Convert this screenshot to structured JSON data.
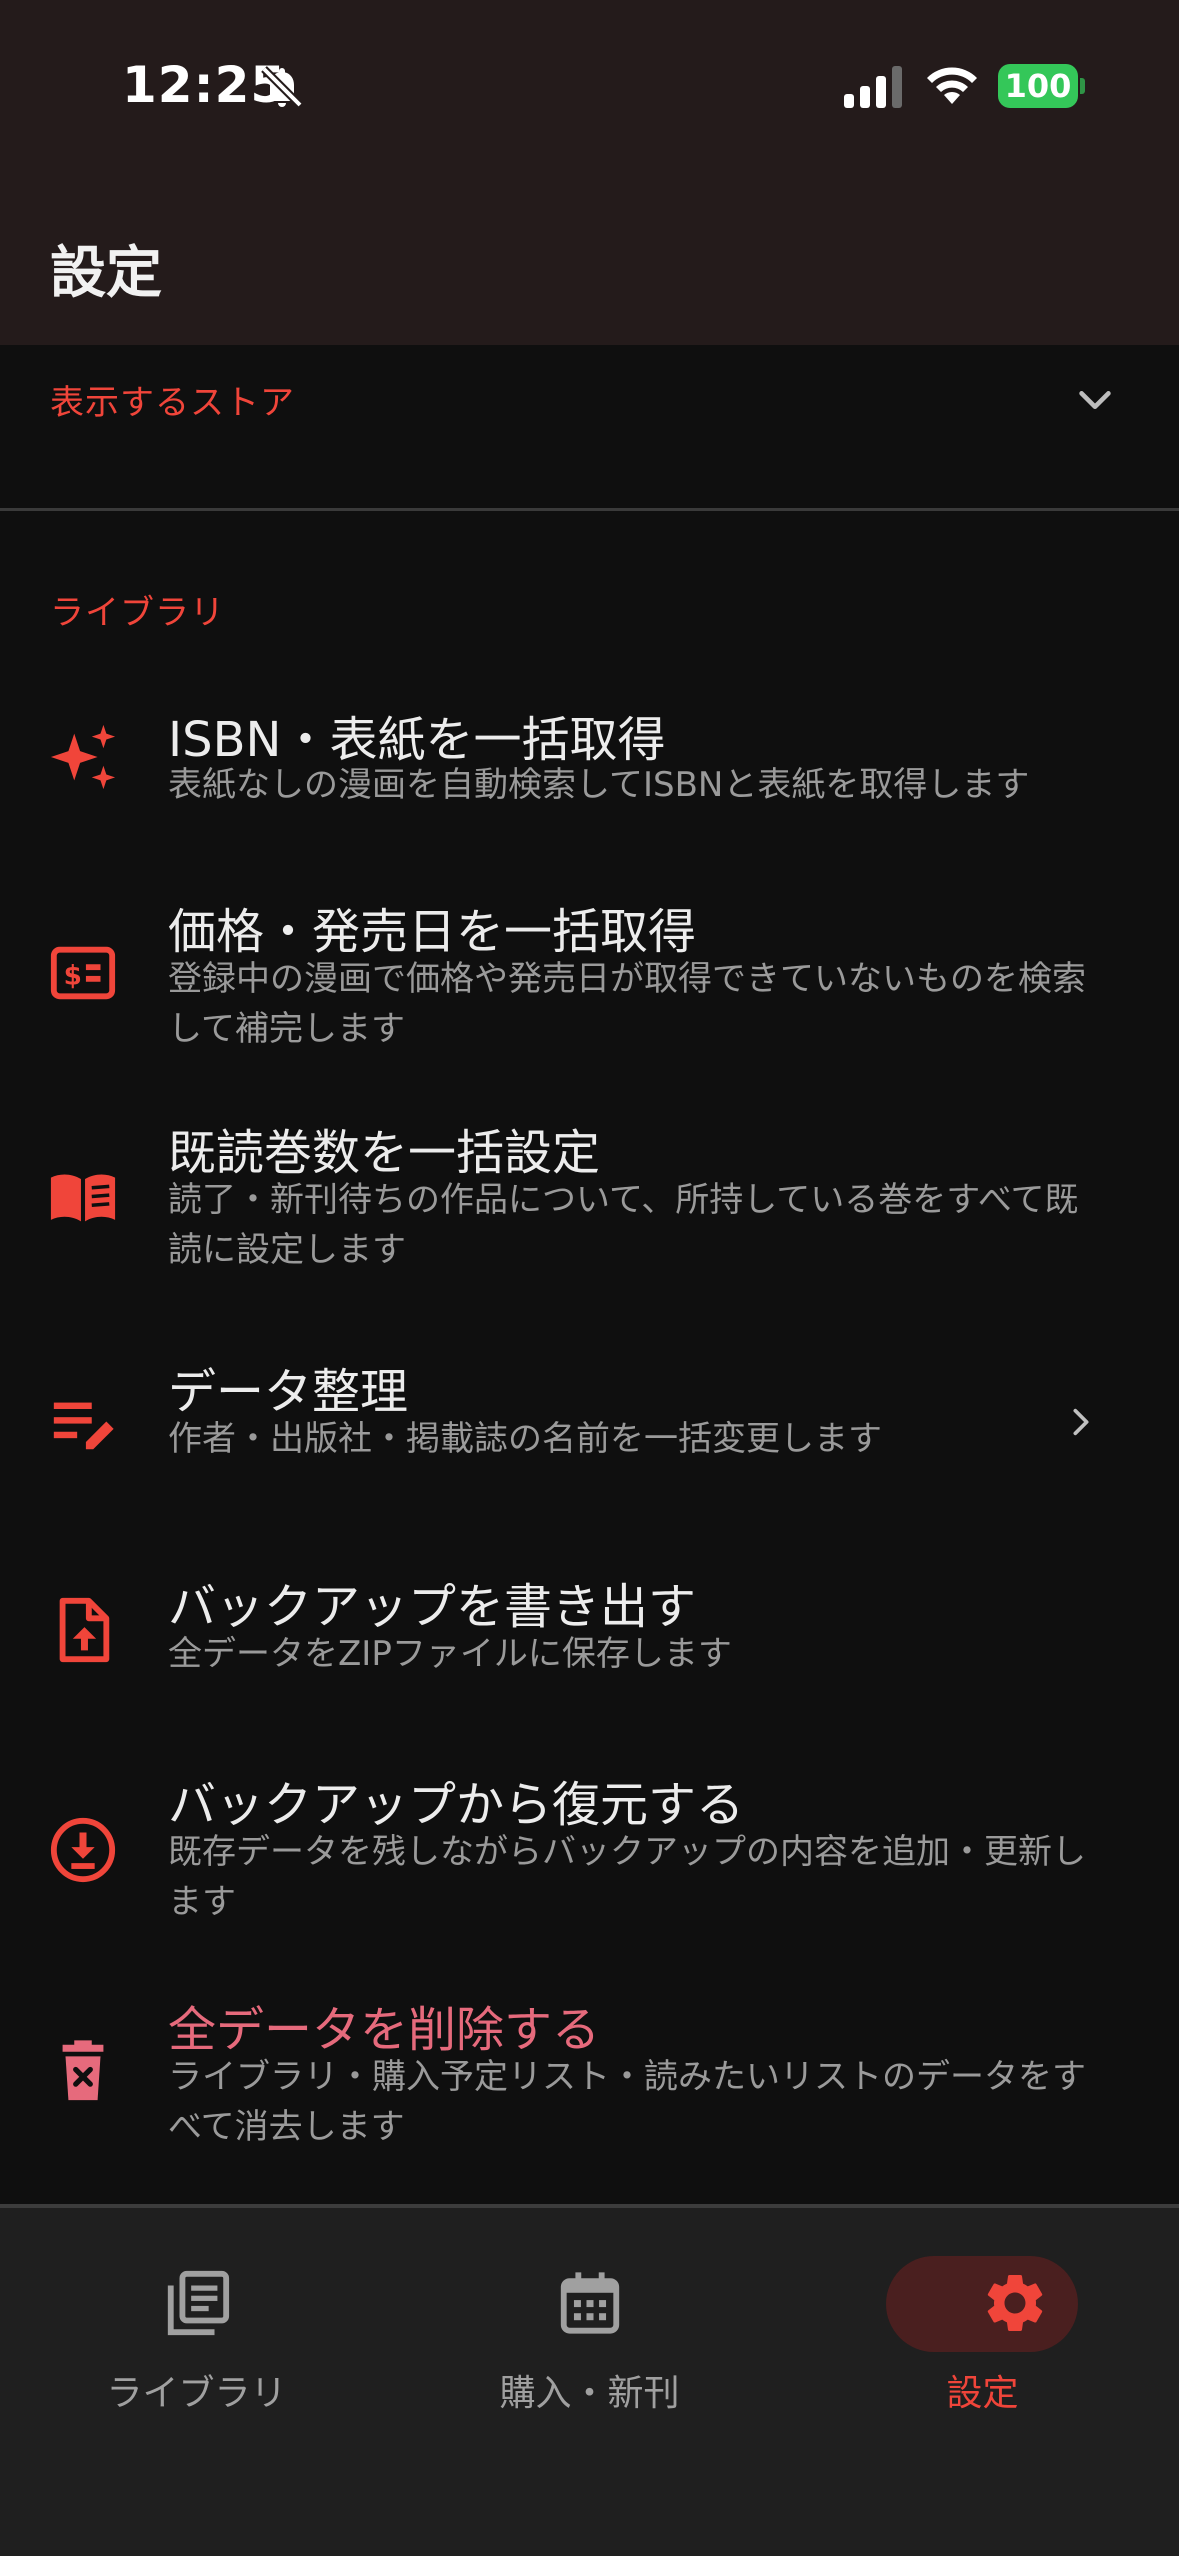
{
  "status_bar": {
    "time": "12:25",
    "battery": "100",
    "battery_color": "#34c759"
  },
  "header": {
    "title": "設定"
  },
  "store_section": {
    "label": "表示するストア",
    "icon": "chevron-down-icon"
  },
  "library_section": {
    "label": "ライブラリ",
    "items": [
      {
        "title": "ISBN・表紙を一括取得",
        "desc": "表紙なしの漫画を自動検索してISBNと表紙を取得します",
        "icon": "sparkles-icon"
      },
      {
        "title": "価格・発売日を一括取得",
        "desc": "登録中の漫画で価格や発売日が取得できていないものを検索して補完します",
        "icon": "price-tag-icon"
      },
      {
        "title": "既読巻数を一括設定",
        "desc": "読了・新刊待ちの作品について、所持している巻をすべて既読に設定します",
        "icon": "open-book-icon"
      },
      {
        "title": "データ整理",
        "desc": "作者・出版社・掲載誌の名前を一括変更します",
        "icon": "edit-list-icon"
      },
      {
        "title": "バックアップを書き出す",
        "desc": "全データをZIPファイルに保存します",
        "icon": "file-upload-icon"
      },
      {
        "title": "バックアップから復元する",
        "desc": "既存データを残しながらバックアップの内容を追加・更新します",
        "icon": "download-circle-icon"
      },
      {
        "title": "全データを削除する",
        "desc": "ライブラリ・購入予定リスト・読みたいリストのデータをすべて消去します",
        "icon": "trash-icon"
      }
    ]
  },
  "bottom_nav": {
    "tabs": [
      {
        "label": "ライブラリ",
        "icon": "library-icon",
        "active": false
      },
      {
        "label": "購入・新刊",
        "icon": "calendar-icon",
        "active": false
      },
      {
        "label": "設定",
        "icon": "gear-icon",
        "active": true
      }
    ]
  },
  "colors": {
    "accent": "#f0453a",
    "danger_text": "#e66a7c",
    "header_bg": "#241b1b",
    "background": "#0f0f0f",
    "nav_bg": "#1f1f1f",
    "active_pill": "#4a1f1f"
  }
}
